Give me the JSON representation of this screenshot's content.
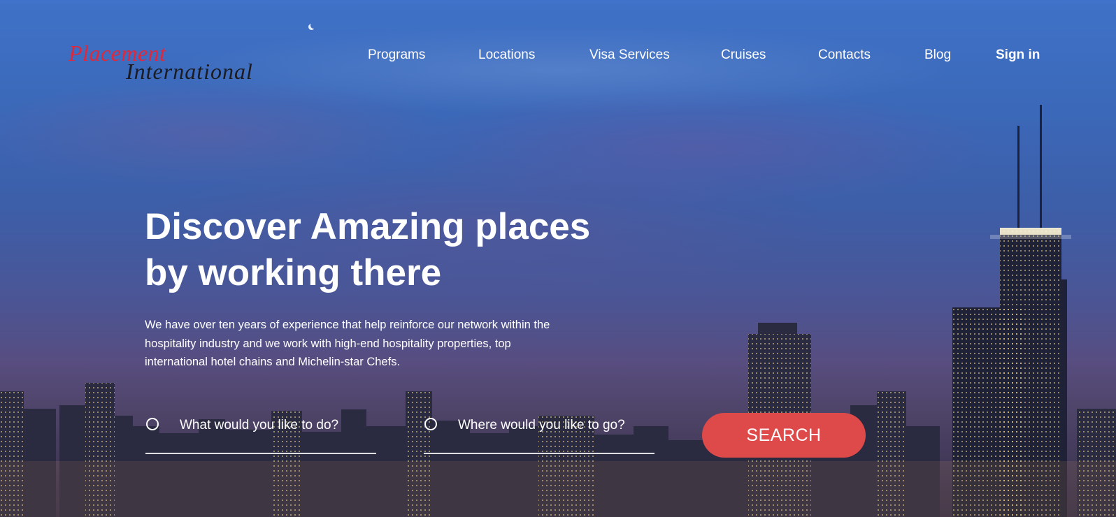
{
  "brand": {
    "line1": "Placement",
    "line2": "International"
  },
  "nav": {
    "items": [
      "Programs",
      "Locations",
      "Visa Services",
      "Cruises",
      "Contacts",
      "Blog"
    ],
    "signin": "Sign in"
  },
  "hero": {
    "headline_line1": "Discover Amazing places",
    "headline_line2": "by working there",
    "intro": "We have over ten years of experience that help reinforce our network within the hospitality industry and we work with high-end hospitality properties, top international hotel chains and Michelin-star Chefs."
  },
  "search": {
    "what_placeholder": "What would you like to do?",
    "where_placeholder": "Where would you like to go?",
    "button_label": "SEARCH"
  },
  "colors": {
    "accent": "#de4949",
    "logo_red": "#e0283a",
    "logo_dark": "#1b1b22",
    "sky_top": "#3f72c8",
    "sky_bottom": "#2c2a45"
  }
}
